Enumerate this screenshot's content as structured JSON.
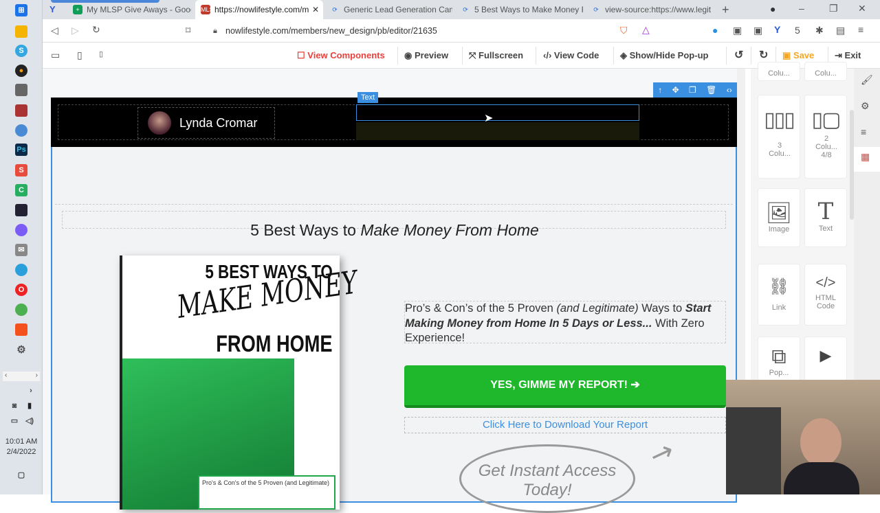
{
  "taskbar": {
    "time": "10:01 AM",
    "date": "2/4/2022"
  },
  "browser": {
    "tabs": [
      {
        "label": "My MLSP Give Aways - Google",
        "active": false
      },
      {
        "label": "https://nowlifestyle.com/m",
        "active": true
      },
      {
        "label": "Generic Lead Generation Cam",
        "active": false
      },
      {
        "label": "5 Best Ways to Make Money F",
        "active": false
      },
      {
        "label": "view-source:https://www.legit",
        "active": false
      }
    ],
    "url": "nowlifestyle.com/members/new_design/pb/editor/21635"
  },
  "editor_toolbar": {
    "view_components": "View Components",
    "preview": "Preview",
    "fullscreen": "Fullscreen",
    "view_code": "View Code",
    "show_hide_popup": "Show/Hide Pop-up",
    "save": "Save",
    "exit": "Exit",
    "accent": "#e8413c"
  },
  "page": {
    "selected_label": "Text",
    "author_name": "Lynda Cromar",
    "headline_plain": "5 Best Ways to ",
    "headline_italic": "Make Money From Home",
    "book": {
      "line1": "5 BEST WAYS TO",
      "line2": "MAKE MONEY",
      "line3": "FROM HOME",
      "bottom": "Pro's & Con's of the 5 Proven (and Legitimate)"
    },
    "description": {
      "p1": "Pro’s & Con’s of the 5 Proven ",
      "p2": "(and Legitimate)",
      "p3": " Ways to ",
      "p4": "Start Making Money from Home In 5 Days or Less...",
      "p5": " With Zero Experience!"
    },
    "cta_button": "YES, GIMME MY REPORT! ➔",
    "cta_color": "#1fb82c",
    "download_link": "Click Here to Download Your Report",
    "instant_access": "Get Instant Access Today!"
  },
  "components": [
    {
      "label": "Colu..."
    },
    {
      "label": "Colu..."
    },
    {
      "label": "3 Colu..."
    },
    {
      "label": "2 Colu... 4/8"
    },
    {
      "label": "Image"
    },
    {
      "label": "Text"
    },
    {
      "label": "Link"
    },
    {
      "label": "HTML Code"
    },
    {
      "label": "Pop..."
    },
    {
      "label": ""
    }
  ]
}
